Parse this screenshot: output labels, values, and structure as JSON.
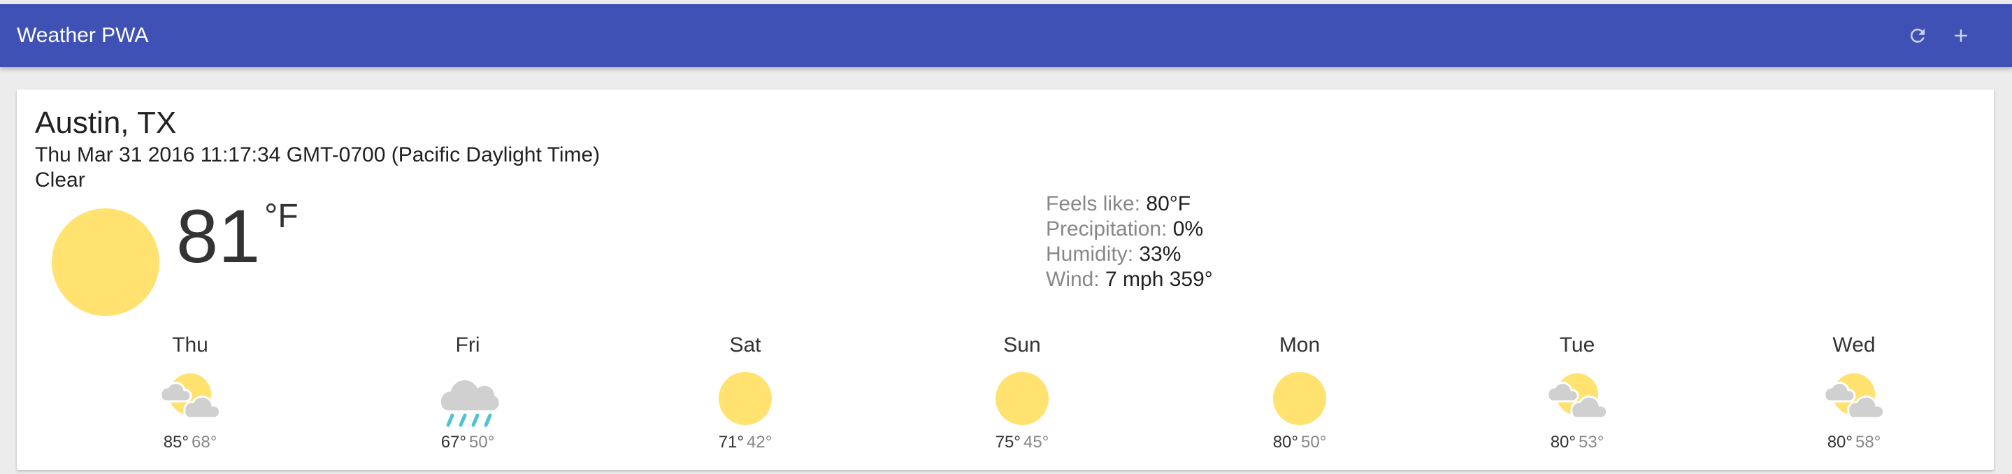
{
  "header": {
    "title": "Weather PWA",
    "refresh_icon": "refresh-icon",
    "add_icon": "plus-icon",
    "color": "#3f51b5"
  },
  "card": {
    "location": "Austin, TX",
    "date": "Thu Mar 31 2016 11:17:34 GMT-0700 (Pacific Daylight Time)",
    "description": "Clear",
    "current_icon": "clear-day-icon",
    "temperature": "81",
    "scale": "°F",
    "details": {
      "feels_like_label": "Feels like:",
      "feels_like_value": "80°F",
      "precip_label": "Precipitation:",
      "precip_value": "0%",
      "humidity_label": "Humidity:",
      "humidity_value": "33%",
      "wind_label": "Wind:",
      "wind_value": "7 mph 359°"
    }
  },
  "forecast": [
    {
      "day": "Thu",
      "icon": "partly-cloudy-icon",
      "high": "85°",
      "low": "68°"
    },
    {
      "day": "Fri",
      "icon": "rain-icon",
      "high": "67°",
      "low": "50°"
    },
    {
      "day": "Sat",
      "icon": "clear-day-icon",
      "high": "71°",
      "low": "42°"
    },
    {
      "day": "Sun",
      "icon": "clear-day-icon",
      "high": "75°",
      "low": "45°"
    },
    {
      "day": "Mon",
      "icon": "clear-day-icon",
      "high": "80°",
      "low": "50°"
    },
    {
      "day": "Tue",
      "icon": "partly-cloudy-icon",
      "high": "80°",
      "low": "53°"
    },
    {
      "day": "Wed",
      "icon": "partly-cloudy-icon",
      "high": "80°",
      "low": "58°"
    }
  ],
  "colors": {
    "sun": "#ffe270",
    "cloud": "#d0d0d0",
    "rain": "#4fc3cf"
  }
}
